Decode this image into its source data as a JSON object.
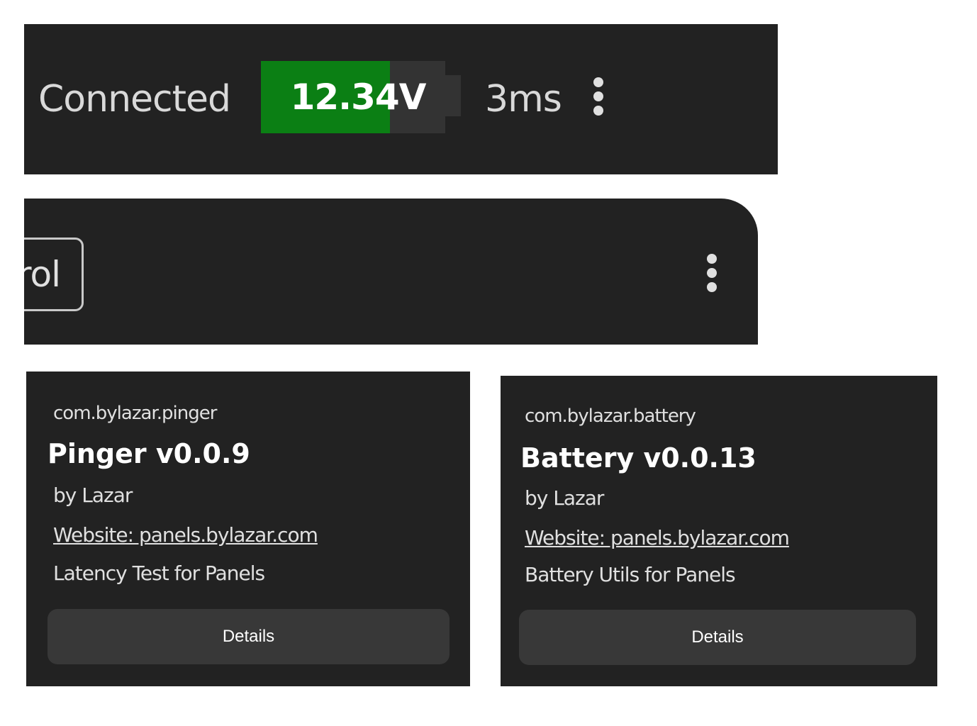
{
  "status_bar": {
    "connection": "Connected",
    "battery": {
      "voltage": "12.34V",
      "level_percent": 70,
      "fill_color": "#0b7f14"
    },
    "latency": "3ms",
    "menu_icon": "more-vertical-icon"
  },
  "toolbar": {
    "tab_label": "rol",
    "menu_icon": "more-vertical-icon"
  },
  "plugins": [
    {
      "package": "com.bylazar.pinger",
      "title": "Pinger v0.0.9",
      "author": "by Lazar",
      "website": "Website: panels.bylazar.com",
      "description": "Latency Test for Panels",
      "button": "Details"
    },
    {
      "package": "com.bylazar.battery",
      "title": "Battery v0.0.13",
      "author": "by Lazar",
      "website": "Website: panels.bylazar.com",
      "description": "Battery Utils for Panels",
      "button": "Details"
    }
  ],
  "colors": {
    "panel_background": "#222222",
    "button_background": "#383838",
    "battery_track": "#333333"
  }
}
